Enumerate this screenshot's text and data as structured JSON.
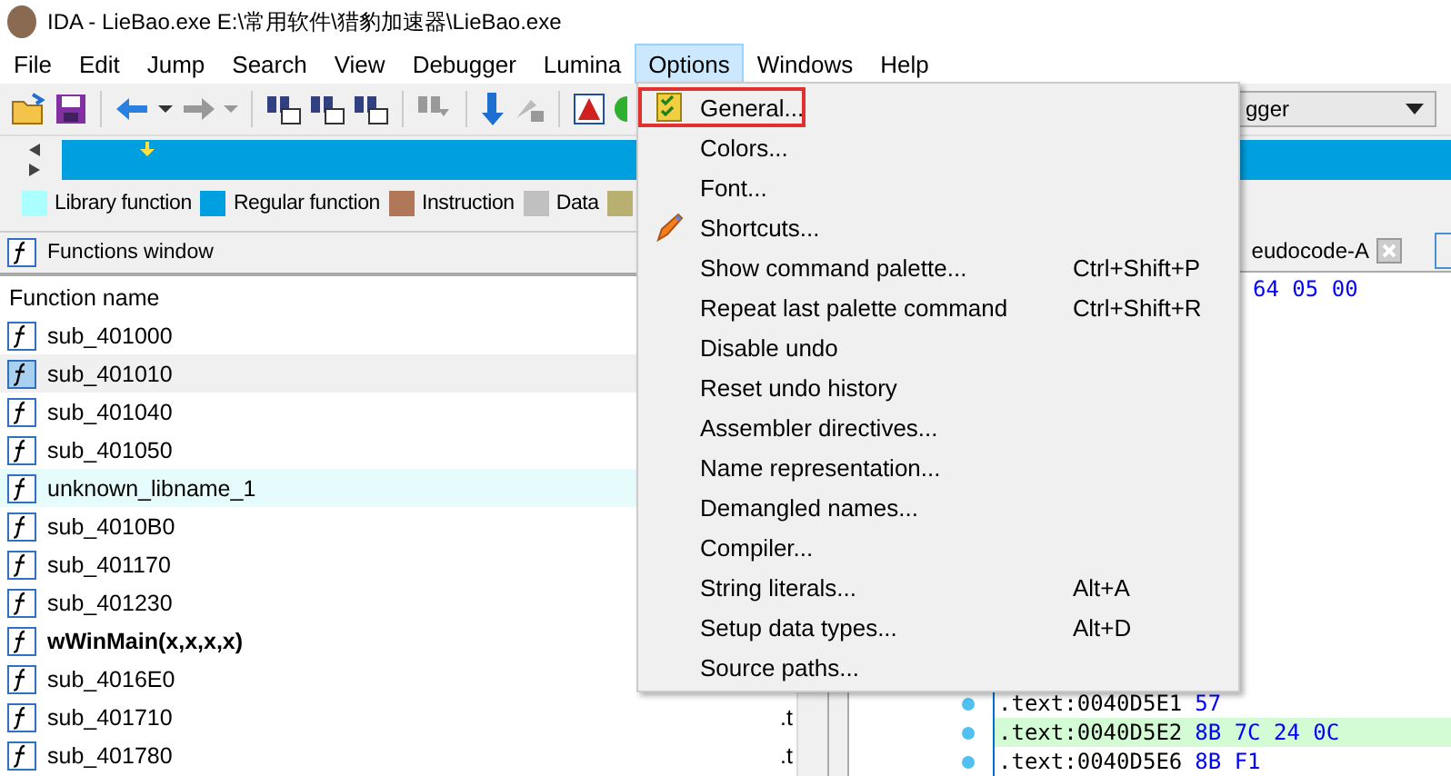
{
  "window": {
    "title": "IDA - LieBao.exe E:\\常用软件\\猎豹加速器\\LieBao.exe"
  },
  "menu_bar": [
    {
      "label": "File",
      "selected": false
    },
    {
      "label": "Edit",
      "selected": false
    },
    {
      "label": "Jump",
      "selected": false
    },
    {
      "label": "Search",
      "selected": false
    },
    {
      "label": "View",
      "selected": false
    },
    {
      "label": "Debugger",
      "selected": false
    },
    {
      "label": "Lumina",
      "selected": false
    },
    {
      "label": "Options",
      "selected": true
    },
    {
      "label": "Windows",
      "selected": false
    },
    {
      "label": "Help",
      "selected": false
    }
  ],
  "debugger_select": {
    "value": "gger"
  },
  "legend": [
    {
      "label": "Library function",
      "color": "#aaffff"
    },
    {
      "label": "Regular function",
      "color": "#00a0e0"
    },
    {
      "label": "Instruction",
      "color": "#b07858"
    },
    {
      "label": "Data",
      "color": "#c0c0c0"
    }
  ],
  "functions_window": {
    "title": "Functions window",
    "columns": [
      "Function name"
    ],
    "rows": [
      {
        "name": "sub_401000",
        "kind": "regular",
        "selected": false
      },
      {
        "name": "sub_401010",
        "kind": "regular",
        "selected": true
      },
      {
        "name": "sub_401040",
        "kind": "regular",
        "selected": false
      },
      {
        "name": "sub_401050",
        "kind": "regular",
        "selected": false
      },
      {
        "name": "unknown_libname_1",
        "kind": "library",
        "selected": false
      },
      {
        "name": "sub_4010B0",
        "kind": "regular",
        "selected": false
      },
      {
        "name": "sub_401170",
        "kind": "regular",
        "selected": false
      },
      {
        "name": "sub_401230",
        "kind": "regular",
        "selected": false
      },
      {
        "name": "wWinMain(x,x,x,x)",
        "kind": "main",
        "selected": false
      },
      {
        "name": "sub_4016E0",
        "kind": "regular",
        "selected": false
      },
      {
        "name": "sub_401710",
        "kind": "regular",
        "selected": false,
        "segment": ".t"
      },
      {
        "name": "sub_401780",
        "kind": "regular",
        "selected": false,
        "segment": ".t"
      }
    ]
  },
  "code_view": {
    "tab": "eudocode-A",
    "top_bytes": "64 05 00",
    "lines": [
      {
        "address": ".text:0040D5E1",
        "bytes": "57",
        "highlighted": false
      },
      {
        "address": ".text:0040D5E2",
        "bytes": "8B 7C 24 0C",
        "highlighted": true
      },
      {
        "address": ".text:0040D5E6",
        "bytes": "8B F1",
        "highlighted": false
      }
    ]
  },
  "options_menu": [
    {
      "label": "General...",
      "kind": "general",
      "highlighted": true
    },
    {
      "label": "Colors...",
      "highlighted": false
    },
    {
      "label": "Font...",
      "highlighted": false
    },
    {
      "label": "Shortcuts...",
      "kind": "shortcuts",
      "highlighted": false
    },
    {
      "label": "Show command palette...",
      "shortcut": "Ctrl+Shift+P",
      "highlighted": false
    },
    {
      "label": "Repeat last palette command",
      "shortcut": "Ctrl+Shift+R",
      "highlighted": false
    },
    {
      "label": "Disable undo",
      "highlighted": false
    },
    {
      "label": "Reset undo history",
      "highlighted": false
    },
    {
      "label": "Assembler directives...",
      "highlighted": false
    },
    {
      "label": "Name representation...",
      "highlighted": false
    },
    {
      "label": "Demangled names...",
      "highlighted": false
    },
    {
      "label": "Compiler...",
      "highlighted": false
    },
    {
      "label": "String literals...",
      "shortcut": "Alt+A",
      "highlighted": false
    },
    {
      "label": "Setup data types...",
      "shortcut": "Alt+D",
      "highlighted": false
    },
    {
      "label": "Source paths...",
      "highlighted": false
    }
  ]
}
